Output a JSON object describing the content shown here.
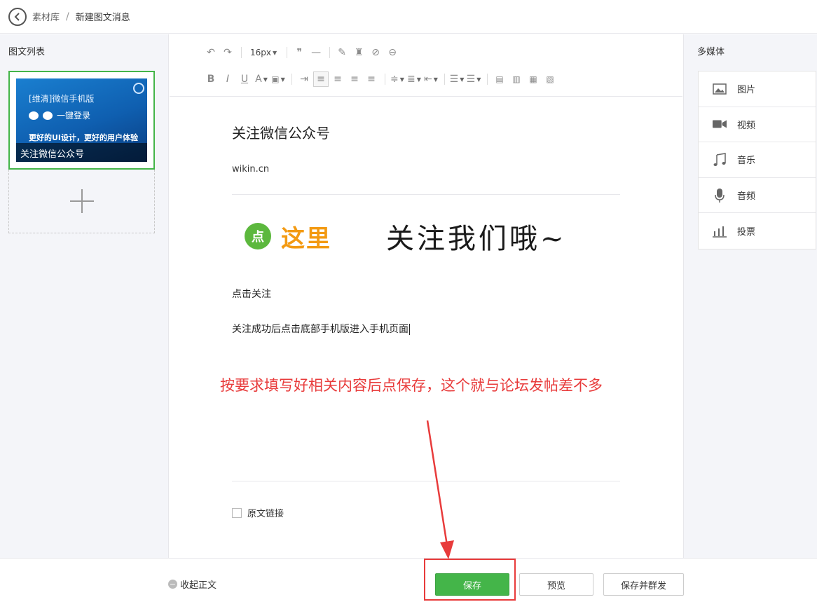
{
  "header": {
    "breadcrumb_parent": "素材库",
    "breadcrumb_separator": "/",
    "breadcrumb_current": "新建图文消息"
  },
  "left_panel": {
    "title": "图文列表",
    "article": {
      "cover_line1": "[维清]微信手机版",
      "cover_line2": "一键登录",
      "cover_line3": "更好的UI设计，更好的用户体验",
      "title": "关注微信公众号"
    }
  },
  "toolbar": {
    "font_size": "16px"
  },
  "editor": {
    "title": "关注微信公众号",
    "author": "wikin.cn",
    "banner_dot": "点",
    "banner_here": "这里",
    "banner_follow": "关注我们哦~",
    "paragraph1": "点击关注",
    "paragraph2": "关注成功后点击底部手机版进入手机页面",
    "annotation": "按要求填写好相关内容后点保存，这个就与论坛发帖差不多",
    "original_link_label": "原文链接"
  },
  "right_panel": {
    "title": "多媒体",
    "items": [
      {
        "label": "图片",
        "icon": "image-icon"
      },
      {
        "label": "视频",
        "icon": "video-icon"
      },
      {
        "label": "音乐",
        "icon": "music-icon"
      },
      {
        "label": "音频",
        "icon": "microphone-icon"
      },
      {
        "label": "投票",
        "icon": "poll-icon"
      }
    ]
  },
  "bottom_bar": {
    "collapse_label": "收起正文",
    "save_label": "保存",
    "preview_label": "预览",
    "save_publish_label": "保存并群发"
  },
  "colors": {
    "accent_green": "#44b549",
    "annotation_red": "#e83b3b"
  }
}
